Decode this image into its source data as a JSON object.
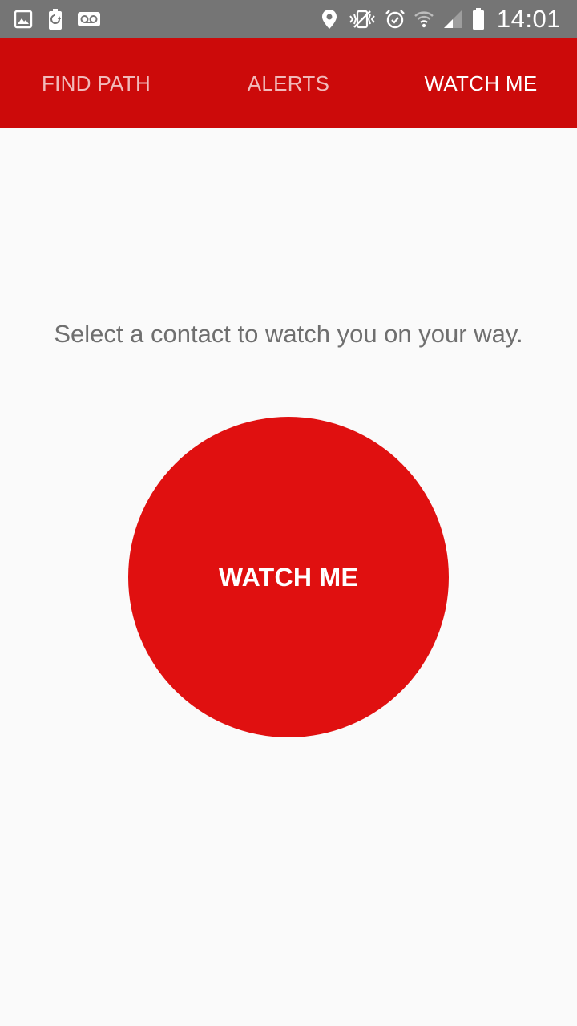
{
  "status_bar": {
    "time": "14:01",
    "left_icons": [
      "image-icon",
      "battery-saver-icon",
      "voicemail-icon"
    ],
    "right_icons": [
      "location-icon",
      "vibrate-icon",
      "alarm-icon",
      "wifi-icon",
      "signal-icon",
      "battery-icon"
    ]
  },
  "tabs": [
    {
      "label": "FIND PATH",
      "active": false
    },
    {
      "label": "ALERTS",
      "active": false
    },
    {
      "label": "WATCH ME",
      "active": true
    }
  ],
  "main": {
    "instruction": "Select a contact to watch you on your way.",
    "button_label": "WATCH ME"
  },
  "colors": {
    "status_bar": "#757575",
    "tab_bar": "#cc0a0a",
    "button": "#e01010",
    "background": "#fafafa",
    "instruction_text": "#6f6f6f"
  }
}
